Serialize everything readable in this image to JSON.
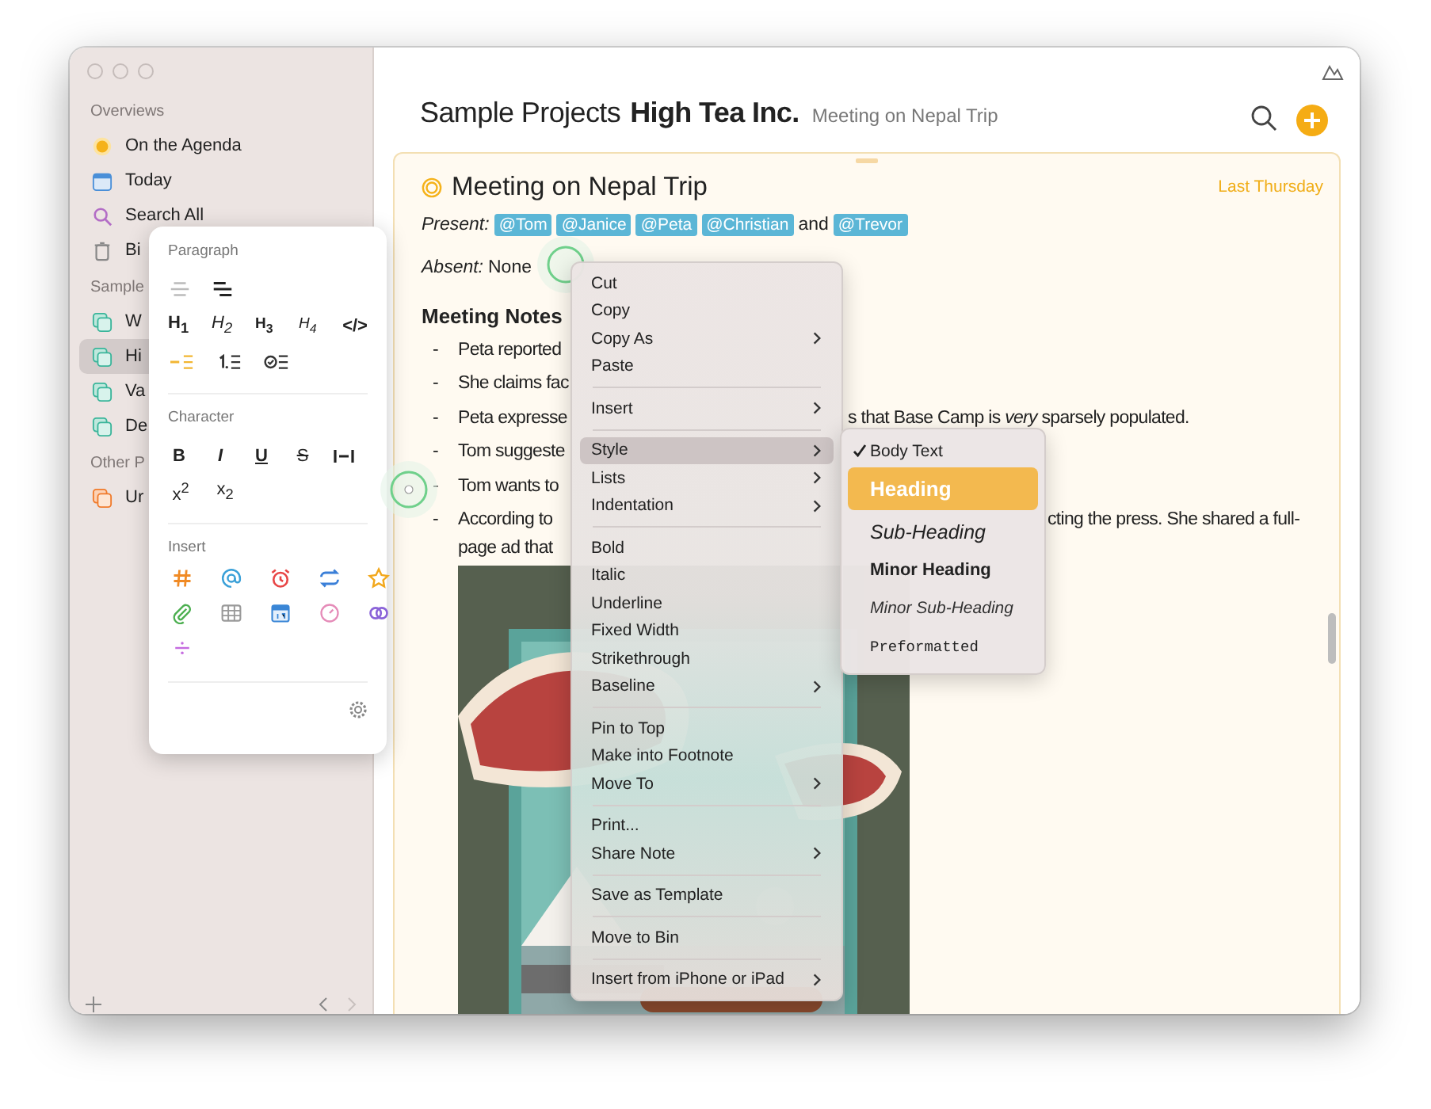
{
  "sidebar": {
    "sections": [
      {
        "title": "Overviews",
        "items": [
          {
            "label": "On the Agenda",
            "kind": "agenda",
            "selected": false
          },
          {
            "label": "Today",
            "kind": "today",
            "selected": false
          },
          {
            "label": "Search All",
            "kind": "search",
            "selected": false
          },
          {
            "label": "Bi",
            "kind": "bin",
            "selected": false
          }
        ]
      },
      {
        "title": "Sample",
        "items": [
          {
            "label": "W",
            "kind": "project",
            "selected": false
          },
          {
            "label": "Hi",
            "kind": "project",
            "selected": true
          },
          {
            "label": "Va",
            "kind": "project",
            "selected": false
          },
          {
            "label": "De",
            "kind": "project",
            "selected": false
          }
        ]
      },
      {
        "title": "Other P",
        "items": [
          {
            "label": "Ur",
            "kind": "inbox",
            "selected": false
          }
        ]
      }
    ]
  },
  "header": {
    "project": "Sample Projects",
    "book": "High Tea Inc.",
    "note": "Meeting on Nepal Trip"
  },
  "note": {
    "title": "Meeting on Nepal Trip",
    "date": "Last Thursday",
    "present_label": "Present:",
    "present": [
      "@Tom",
      "@Janice",
      "@Peta",
      "@Christian"
    ],
    "present_and": "and",
    "present_last": "@Trevor",
    "absent_label": "Absent:",
    "absent": "None",
    "section": "Meeting Notes",
    "bullets": [
      {
        "marker": "-",
        "text": "Peta reported"
      },
      {
        "marker": "-",
        "text": "She claims fac"
      },
      {
        "marker": "-",
        "text": "Peta expresse",
        "tail": "s that Base Camp is *very* sparsely populated."
      },
      {
        "marker": "-",
        "text": "Tom suggeste"
      },
      {
        "marker": "-",
        "text": "Tom wants to"
      },
      {
        "marker": "-",
        "text": "According to",
        "tail": "cting the press. She shared a full-",
        "continuation": "page ad that"
      }
    ]
  },
  "format_popover": {
    "paragraph_title": "Paragraph",
    "align": [
      {
        "kind": "outdent"
      },
      {
        "kind": "indent"
      }
    ],
    "headings": [
      {
        "label": "H$_{1}$",
        "kind": "h1"
      },
      {
        "label": "H$_{2}$",
        "kind": "h2"
      },
      {
        "label": "H$_{3}$",
        "kind": "h3"
      },
      {
        "label": "H$_{4}$",
        "kind": "h4"
      },
      {
        "label": "</>",
        "kind": "code"
      }
    ],
    "lists": [
      {
        "kind": "bullets",
        "selected": true
      },
      {
        "kind": "numbers",
        "selected": false
      },
      {
        "kind": "checklist",
        "selected": false
      }
    ],
    "character_title": "Character",
    "character": [
      {
        "label": "B",
        "kind": "bold"
      },
      {
        "label": "I",
        "kind": "italic"
      },
      {
        "label": "U",
        "kind": "underline"
      },
      {
        "label": "S",
        "kind": "strike"
      },
      {
        "kind": "fixed"
      },
      {
        "label": "x$^{2}$",
        "kind": "plain"
      },
      {
        "label": "x$_{2}$",
        "kind": "plain"
      }
    ],
    "insert_title": "Insert",
    "insert": [
      {
        "kind": "hashtag"
      },
      {
        "kind": "at"
      },
      {
        "kind": "alarm"
      },
      {
        "kind": "repeat"
      },
      {
        "kind": "star"
      },
      {
        "kind": "clip"
      },
      {
        "kind": "table"
      },
      {
        "kind": "calendar"
      },
      {
        "kind": "clock"
      },
      {
        "kind": "link"
      },
      {
        "kind": "divide"
      }
    ]
  },
  "context_menu": {
    "groups": [
      [
        {
          "label": "Cut",
          "submenu": false,
          "selected": false
        },
        {
          "label": "Copy",
          "submenu": false,
          "selected": false
        },
        {
          "label": "Copy As",
          "submenu": true,
          "selected": false
        },
        {
          "label": "Paste",
          "submenu": false,
          "selected": false
        }
      ],
      [
        {
          "label": "Insert",
          "submenu": true,
          "selected": false
        }
      ],
      [
        {
          "label": "Style",
          "submenu": true,
          "selected": true
        },
        {
          "label": "Lists",
          "submenu": true,
          "selected": false
        },
        {
          "label": "Indentation",
          "submenu": true,
          "selected": false
        }
      ],
      [
        {
          "label": "Bold",
          "submenu": false,
          "selected": false
        },
        {
          "label": "Italic",
          "submenu": false,
          "selected": false
        },
        {
          "label": "Underline",
          "submenu": false,
          "selected": false
        },
        {
          "label": "Fixed Width",
          "submenu": false,
          "selected": false
        },
        {
          "label": "Strikethrough",
          "submenu": false,
          "selected": false
        },
        {
          "label": "Baseline",
          "submenu": true,
          "selected": false
        }
      ],
      [
        {
          "label": "Pin to Top",
          "submenu": false,
          "selected": false
        },
        {
          "label": "Make into Footnote",
          "submenu": false,
          "selected": false
        },
        {
          "label": "Move To",
          "submenu": true,
          "selected": false
        }
      ],
      [
        {
          "label": "Print...",
          "submenu": false,
          "selected": false
        },
        {
          "label": "Share Note",
          "submenu": true,
          "selected": false
        }
      ],
      [
        {
          "label": "Save as Template",
          "submenu": false,
          "selected": false
        }
      ],
      [
        {
          "label": "Move to Bin",
          "submenu": false,
          "selected": false
        }
      ],
      [
        {
          "label": "Insert from iPhone or iPad",
          "submenu": true,
          "selected": false
        }
      ]
    ]
  },
  "style_submenu": [
    {
      "label": "Body Text",
      "kind": "body",
      "checked": true,
      "selected": false
    },
    {
      "label": "Heading",
      "kind": "heading",
      "checked": false,
      "selected": true
    },
    {
      "label": "Sub-Heading",
      "kind": "subheading",
      "checked": false,
      "selected": false
    },
    {
      "label": "Minor Heading",
      "kind": "minor",
      "checked": false,
      "selected": false
    },
    {
      "label": "Minor Sub-Heading",
      "kind": "minorsub",
      "checked": false,
      "selected": false
    },
    {
      "label": "Preformatted",
      "kind": "pre",
      "checked": false,
      "selected": false
    }
  ]
}
